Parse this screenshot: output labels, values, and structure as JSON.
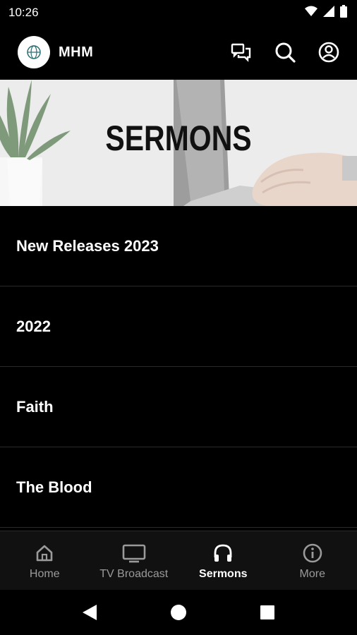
{
  "status": {
    "time": "10:26"
  },
  "app": {
    "title": "MHM"
  },
  "hero": {
    "title": "SERMONS"
  },
  "list": [
    "New Releases 2023",
    "2022",
    "Faith",
    "The Blood"
  ],
  "nav": [
    {
      "label": "Home",
      "icon": "home-icon",
      "active": false
    },
    {
      "label": "TV Broadcast",
      "icon": "tv-icon",
      "active": false
    },
    {
      "label": "Sermons",
      "icon": "headphones-icon",
      "active": true
    },
    {
      "label": "More",
      "icon": "info-icon",
      "active": false
    }
  ],
  "colors": {
    "background": "#000000",
    "nav_bg": "#111111",
    "inactive": "#9a9a9a",
    "active": "#ffffff"
  }
}
